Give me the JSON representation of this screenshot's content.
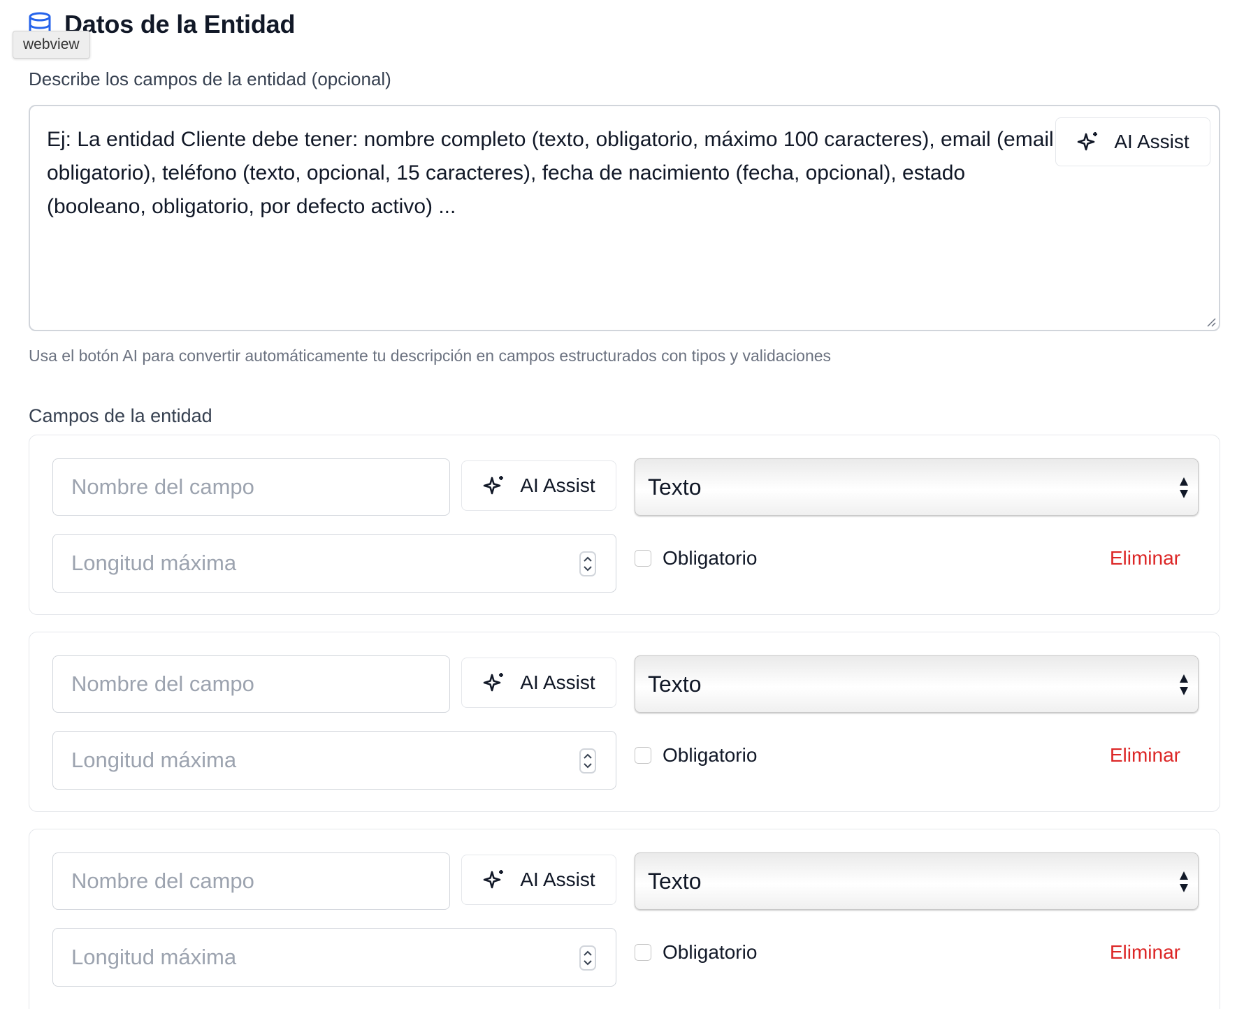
{
  "colors": {
    "accent_icon": "#2563eb",
    "danger": "#dc2626",
    "border": "#d1d5db",
    "placeholder": "#9ca3af"
  },
  "header": {
    "title": "Datos de la Entidad",
    "icon": "database-icon"
  },
  "tooltip": {
    "text": "webview"
  },
  "description": {
    "label": "Describe los campos de la entidad (opcional)",
    "placeholder": "Ej: La entidad Cliente debe tener: nombre completo (texto, obligatorio, máximo 100 caracteres), email (email, obligatorio), teléfono (texto, opcional, 15 caracteres), fecha de nacimiento (fecha, opcional), estado (booleano, obligatorio, por defecto activo) ...",
    "ai_button": "AI Assist",
    "hint": "Usa el botón AI para convertir automáticamente tu descripción en campos estructurados con tipos y validaciones"
  },
  "fields_section": {
    "label": "Campos de la entidad",
    "fields": [
      {
        "name_placeholder": "Nombre del campo",
        "ai_button": "AI Assist",
        "type": "Texto",
        "length_placeholder": "Longitud máxima",
        "required_label": "Obligatorio",
        "required": false,
        "delete_label": "Eliminar"
      },
      {
        "name_placeholder": "Nombre del campo",
        "ai_button": "AI Assist",
        "type": "Texto",
        "length_placeholder": "Longitud máxima",
        "required_label": "Obligatorio",
        "required": false,
        "delete_label": "Eliminar"
      },
      {
        "name_placeholder": "Nombre del campo",
        "ai_button": "AI Assist",
        "type": "Texto",
        "length_placeholder": "Longitud máxima",
        "required_label": "Obligatorio",
        "required": false,
        "delete_label": "Eliminar"
      }
    ]
  }
}
